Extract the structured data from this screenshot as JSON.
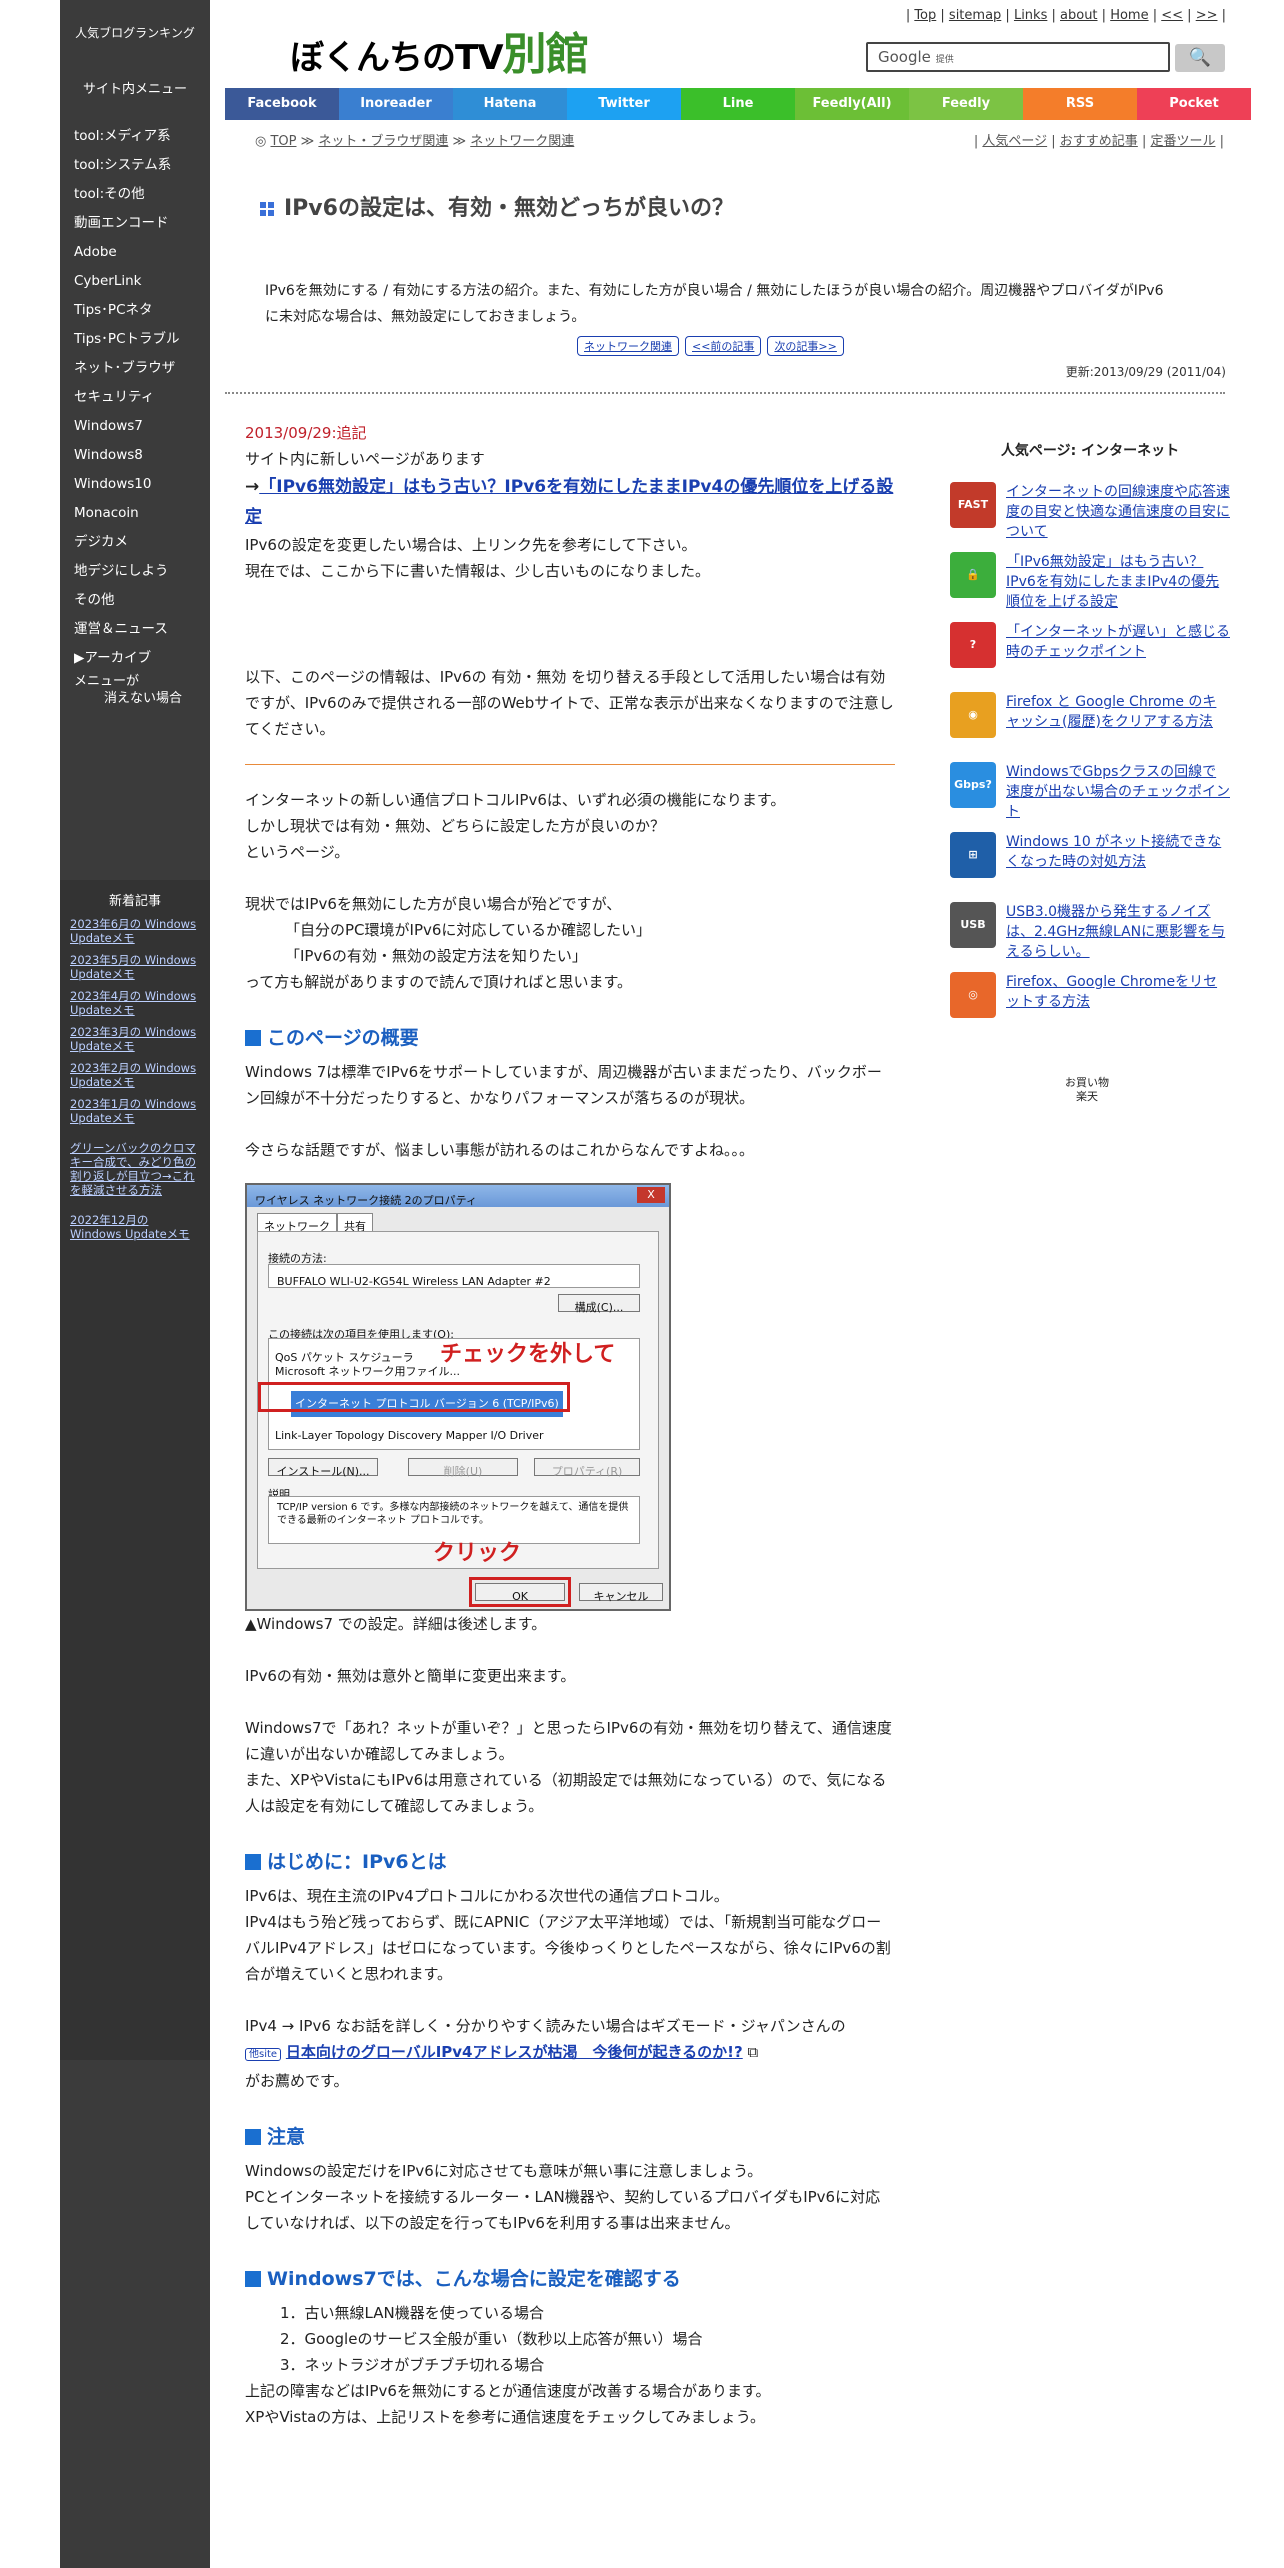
{
  "sidebar": {
    "ranking": "人気ブログランキング",
    "menu_title": "サイト内メニュー",
    "items": [
      "tool:メディア系",
      "tool:システム系",
      "tool:その他",
      "動画エンコード",
      "Adobe",
      "CyberLink",
      "Tips･PCネタ",
      "Tips･PCトラブル",
      "ネット･ブラウザ",
      "セキュリティ",
      "Windows7",
      "Windows8",
      "Windows10",
      "Monacoin",
      "デジカメ",
      "地デジにしよう",
      "その他",
      "運営＆ニュース",
      "▶アーカイブ"
    ],
    "menu_gone_1": "メニューが",
    "menu_gone_2": "消えない場合",
    "news_title": "新着記事",
    "news": [
      "2023年6月の Windows Updateメモ",
      "2023年5月の Windows Updateメモ",
      "2023年4月の Windows Updateメモ",
      "2023年3月の Windows Updateメモ",
      "2023年2月の Windows Updateメモ",
      "2023年1月の Windows Updateメモ",
      "グリーンバックのクロマキー合成で、みどり色の割り返しが目立つ→これを軽減させる方法",
      "2022年12月の Windows Updateメモ"
    ]
  },
  "header": {
    "toplinks": [
      "Top",
      "sitemap",
      "Links",
      "about",
      "Home",
      "<<",
      ">>"
    ],
    "logo_a": "ぼくんちのTV",
    "logo_b": "別館",
    "search_label": "Google",
    "search_sub": "提供",
    "search_btn": "🔍",
    "social": [
      {
        "label": "Facebook",
        "color": "#3b5998"
      },
      {
        "label": "Inoreader",
        "color": "#3a7fd0"
      },
      {
        "label": "Hatena",
        "color": "#2f8ed6"
      },
      {
        "label": "Twitter",
        "color": "#1da1f2"
      },
      {
        "label": "Line",
        "color": "#3bbf2a"
      },
      {
        "label": "Feedly(All)",
        "color": "#6cbf36"
      },
      {
        "label": "Feedly",
        "color": "#7cc344"
      },
      {
        "label": "RSS",
        "color": "#f47d2a"
      },
      {
        "label": "Pocket",
        "color": "#ee4056"
      }
    ],
    "crumbs": [
      "TOP",
      "ネット・ブラウザ関連",
      "ネットワーク関連"
    ],
    "subnav": [
      "人気ページ",
      "おすすめ記事",
      "定番ツール"
    ]
  },
  "page": {
    "title": "IPv6の設定は、有効・無効どっちが良いの？",
    "desc": "IPv6を無効にする / 有効にする方法の紹介。また、有効にした方が良い場合 / 無効にしたほうが良い場合の紹介。周辺機器やプロバイダがIPv6に未対応な場合は、無効設定にしておきましょう。",
    "navbtns": [
      "ネットワーク関連",
      "<<前の記事",
      "次の記事>>"
    ],
    "updated": "更新:2013/09/29 (2011/04)"
  },
  "article": {
    "addendum_date": "2013/09/29:追記",
    "p1": "サイト内に新しいページがあります",
    "link1_prefix": "→",
    "link1": "「IPv6無効設定」はもう古い？IPv6を有効にしたままIPv4の優先順位を上げる設定",
    "p2": "IPv6の設定を変更したい場合は、上リンク先を参考にして下さい。",
    "p3": "現在では、ここから下に書いた情報は、少し古いものになりました。",
    "p4": "以下、このページの情報は、IPv6の 有効・無効 を切り替える手段として活用したい場合は有効ですが、IPv6のみで提供される一部のWebサイトで、正常な表示が出来なくなりますので注意してください。",
    "p5a": "インターネットの新しい通信プロトコルIPv6は、いずれ必須の機能になります。",
    "p5b": "しかし現状では有効・無効、どちらに設定した方が良いのか？",
    "p5c": "というページ。",
    "p6a": "現状ではIPv6を無効にした方が良い場合が殆どですが、",
    "p6b": "「自分のPC環境がIPv6に対応しているか確認したい」",
    "p6c": "「IPv6の有効・無効の設定方法を知りたい」",
    "p6d": "って方も解説がありますので読んで頂ければと思います。",
    "h1": "このページの概要",
    "p7": "Windows 7は標準でIPv6をサポートしていますが、周辺機器が古いままだったり、バックボーン回線が不十分だったりすると、かなりパフォーマンスが落ちるのが現状。",
    "p8": "今さらな話題ですが、悩ましい事態が訪れるのはこれからなんですよね。。。",
    "shot": {
      "titlebar": "ワイヤレス ネットワーク接続 2のプロパティ",
      "close": "X",
      "tab1": "ネットワーク",
      "tab2": "共有",
      "conn_label": "接続の方法:",
      "adapter": "BUFFALO WLI-U2-KG54L Wireless LAN Adapter #2",
      "config_btn": "構成(C)...",
      "items_label": "この接続は次の項目を使用します(O):",
      "item1": "QoS パケット スケジューラ",
      "item2": "Microsoft ネットワーク用ファイル...",
      "item3": "インターネット プロトコル バージョン 6 (TCP/IPv6)",
      "item4": "Link-Layer Topology Discovery Mapper I/O Driver",
      "callout1": "チェックを外して",
      "install_btn": "インストール(N)...",
      "remove_btn": "削除(U)",
      "prop_btn": "プロパティ(R)",
      "desc_label": "説明",
      "desc_text": "TCP/IP version 6 です。多様な内部接続のネットワークを越えて、通信を提供できる最新のインターネット プロトコルです。",
      "callout2": "クリック",
      "ok": "OK",
      "cancel": "キャンセル"
    },
    "caption": "▲Windows7 での設定。詳細は後述します。",
    "p9": "IPv6の有効・無効は意外と簡単に変更出来ます。",
    "p10a": "Windows7で「あれ？ネットが重いぞ？」と思ったらIPv6の有効・無効を切り替えて、通信速度に違いが出ないか確認してみましょう。",
    "p10b": "また、XPやVistaにもIPv6は用意されている（初期設定では無効になっている）ので、気になる人は設定を有効にして確認してみましょう。",
    "h2": "はじめに：IPv6とは",
    "p11a": "IPv6は、現在主流のIPv4プロトコルにかわる次世代の通信プロトコル。",
    "p11b": "IPv4はもう殆ど残っておらず、既にAPNIC（アジア太平洋地域）では、「新規割当可能なグローバルIPv4アドレス」はゼロになっています。今後ゆっくりとしたペースながら、徐々にIPv6の割合が増えていくと思われます。",
    "p12a": "IPv4 → IPv6 なお話を詳しく・分かりやすく読みたい場合はギズモード・ジャパンさんの",
    "site_tag": "他site",
    "link2": "日本向けのグローバルIPv4アドレスが枯渇　今後何が起きるのか!?",
    "p12b": "がお薦めです。",
    "h3": "注意",
    "p13a": "Windowsの設定だけをIPv6に対応させても意味が無い事に注意しましょう。",
    "p13b": "PCとインターネットを接続するルーター・LAN機器や、契約しているプロバイダもIPv6に対応していなければ、以下の設定を行ってもIPv6を利用する事は出来ません。",
    "h4": "Windows7では、こんな場合に設定を確認する",
    "list": [
      "1．古い無線LAN機器を使っている場合",
      "2．Googleのサービス全般が重い（数秒以上応答が無い）場合",
      "3．ネットラジオがブチブチ切れる場合"
    ],
    "p14a": "上記の障害などはIPv6を無効にするとが通信速度が改善する場合があります。",
    "p14b": "XPやVistaの方は、上記リストを参考に通信速度をチェックしてみましょう。"
  },
  "side": {
    "title": "人気ページ: インターネット",
    "items": [
      {
        "icon": "FAST",
        "color": "#c23a2a",
        "text": "インターネットの回線速度や応答速度の目安と快適な通信速度の目安について"
      },
      {
        "icon": "🔒",
        "color": "#3cae3c",
        "text": "「IPv6無効設定」はもう古い？IPv6を有効にしたままIPv4の優先順位を上げる設定"
      },
      {
        "icon": "?",
        "color": "#d63030",
        "text": "「インターネットが遅い」と感じる時のチェックポイント"
      },
      {
        "icon": "◉",
        "color": "#e8a020",
        "text": "Firefox と Google Chrome のキャッシュ(履歴)をクリアする方法"
      },
      {
        "icon": "Gbps?",
        "color": "#2a8ee0",
        "text": "WindowsでGbpsクラスの回線で速度が出ない場合のチェックポイント"
      },
      {
        "icon": "⊞",
        "color": "#1f5fa8",
        "text": "Windows 10 がネット接続できなくなった時の対処方法"
      },
      {
        "icon": "USB",
        "color": "#555555",
        "text": "USB3.0機器から発生するノイズは、2.4GHz無線LANに悪影響を与えるらしい。"
      },
      {
        "icon": "◎",
        "color": "#e8672a",
        "text": "Firefox、Google Chromeをリセットする方法"
      }
    ],
    "shop": "お買い物",
    "shop_img": "楽天"
  }
}
